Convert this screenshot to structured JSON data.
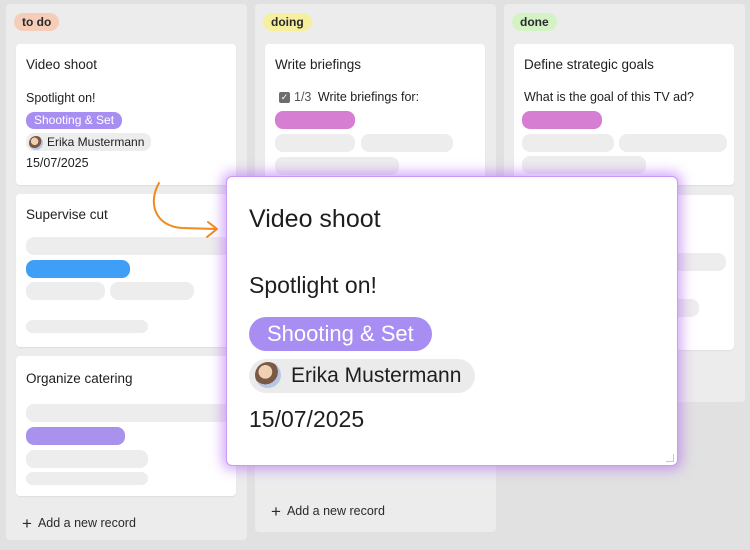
{
  "columns": [
    {
      "tag": "to do",
      "tag_color": "#f6cdb8",
      "cards": [
        {
          "title": "Video shoot",
          "text": "Spotlight on!",
          "chip": "Shooting & Set",
          "user": "Erika Mustermann",
          "date": "15/07/2025"
        },
        {
          "title": "Supervise cut"
        },
        {
          "title": "Organize catering"
        }
      ],
      "add_label": "Add a new record"
    },
    {
      "tag": "doing",
      "tag_color": "#f6ef9e",
      "cards": [
        {
          "title": "Write briefings",
          "checklist_count": "1/3",
          "text": "Write briefings for:"
        }
      ],
      "add_label": "Add a new record"
    },
    {
      "tag": "done",
      "tag_color": "#d3f3c4",
      "cards": [
        {
          "title": "Define strategic goals",
          "text": "What is the goal of this TV ad?"
        }
      ]
    }
  ],
  "popup": {
    "title": "Video shoot",
    "text": "Spotlight on!",
    "chip": "Shooting & Set",
    "user": "Erika Mustermann",
    "date": "15/07/2025"
  },
  "colors": {
    "chip_purple": "#a88ef3",
    "placeholder_pink": "#d67fd2",
    "placeholder_blue": "#3f9ef6",
    "arrow_orange": "#f08a1c",
    "popup_glow": "#b066f0"
  },
  "icons": {
    "plus": "plus-icon",
    "checkbox": "checkbox-icon",
    "avatar": "avatar",
    "arrow": "curved-arrow-icon"
  }
}
